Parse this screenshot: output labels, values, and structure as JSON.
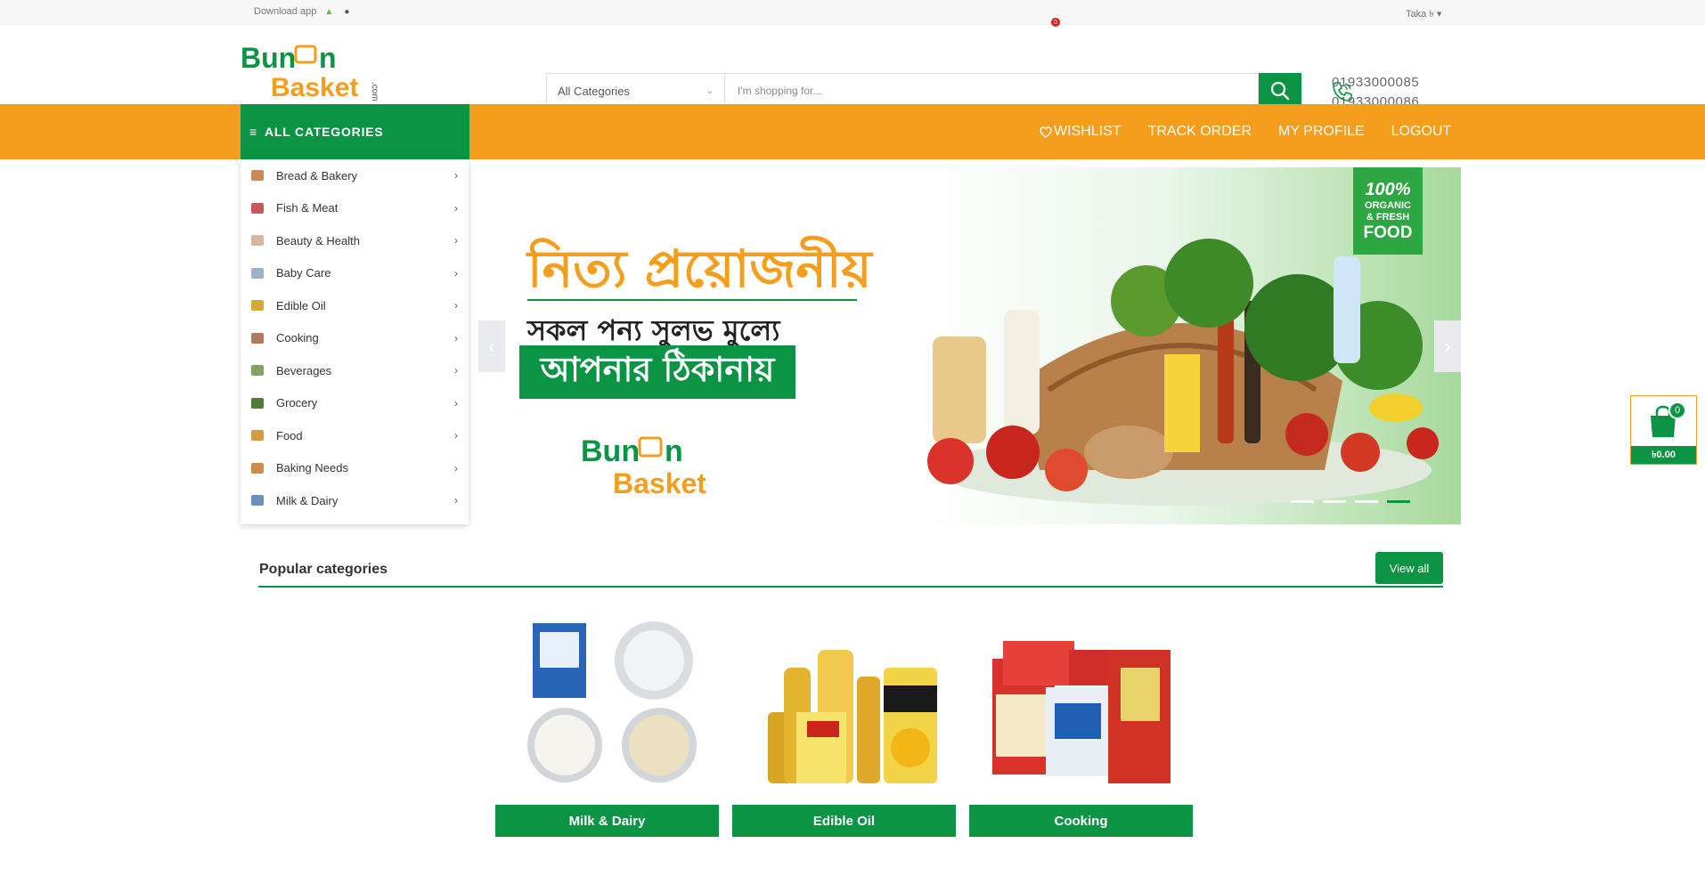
{
  "topbar": {
    "download_label": "Download app",
    "currency_label": "Taka ৳"
  },
  "header": {
    "logo_line1": "Bun",
    "logo_line1b": "n",
    "logo_line2": "Basket",
    "logo_com": ".com",
    "category_select": "All Categories",
    "search_placeholder": "I'm shopping for...",
    "phone1": "01933000085",
    "phone2": "01933000086"
  },
  "nav": {
    "all_categories": "ALL CATEGORIES",
    "wishlist": "WISHLIST",
    "wishlist_count": "0",
    "track_order": "TRACK ORDER",
    "my_profile": "MY PROFILE",
    "logout": "LOGOUT"
  },
  "sidebar": {
    "items": [
      {
        "label": "Bread & Bakery",
        "color": "#c98a55"
      },
      {
        "label": "Fish & Meat",
        "color": "#c45a5a"
      },
      {
        "label": "Beauty & Health",
        "color": "#d7b7a0"
      },
      {
        "label": "Baby Care",
        "color": "#9bb3c9"
      },
      {
        "label": "Edible Oil",
        "color": "#d4a93a"
      },
      {
        "label": "Cooking",
        "color": "#b07b5a"
      },
      {
        "label": "Beverages",
        "color": "#7fa36b"
      },
      {
        "label": "Grocery",
        "color": "#4e7a3a"
      },
      {
        "label": "Food",
        "color": "#d99a3a"
      },
      {
        "label": "Baking Needs",
        "color": "#d08a4a"
      },
      {
        "label": "Milk & Dairy",
        "color": "#6a8fc0"
      }
    ]
  },
  "banner": {
    "line1": "নিত্য প্রয়োজনীয়",
    "line2": "সকল পন্য সুলভ মুল্যে",
    "line3": "আপনার ঠিকানায়",
    "badge_pct": "100%",
    "badge_line1": "ORGANIC",
    "badge_line2": "& FRESH",
    "badge_line3": "FOOD",
    "slides": 4,
    "active_slide": 4
  },
  "cart": {
    "count": "0",
    "price": "৳0.00"
  },
  "popular": {
    "title": "Popular categories",
    "view_all": "View all",
    "cards": [
      {
        "label": "Milk & Dairy"
      },
      {
        "label": "Edible Oil"
      },
      {
        "label": "Cooking"
      }
    ]
  },
  "colors": {
    "brand_green": "#0b9444",
    "brand_orange": "#f59e1e"
  }
}
